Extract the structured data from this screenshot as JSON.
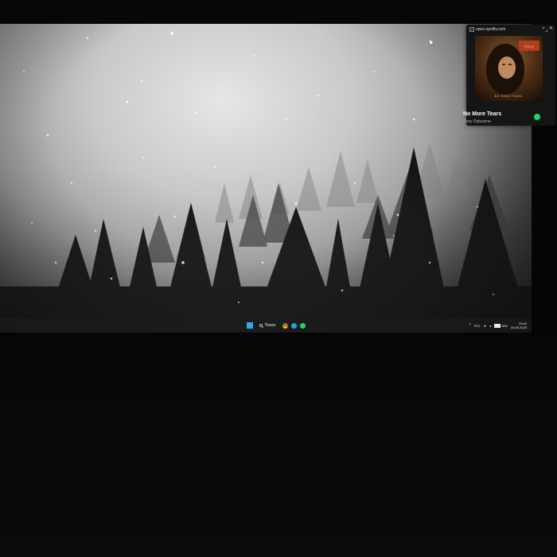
{
  "popup": {
    "url": "open.spotify.com",
    "track_title": "No More Tears",
    "artist": "Ozzy Osbourne",
    "album_logo": "Ozzy Osbourne",
    "album_caption": "NO MORE TEARS",
    "accent": "#1ed760",
    "icons": [
      "pip-icon",
      "expand-icon",
      "close-icon",
      "liked-check-icon"
    ]
  },
  "taskbar": {
    "search_label": "Поиск",
    "apps": [
      "start-icon",
      "chrome-icon",
      "telegram-icon",
      "spotify-icon"
    ],
    "tray": {
      "language": "РУС",
      "battery": "78%",
      "time": "23:42",
      "date": "30.05.2025"
    }
  },
  "wallpaper": {
    "description_colors": {
      "fog": "#c9c9c9",
      "trees": "#141414"
    }
  }
}
